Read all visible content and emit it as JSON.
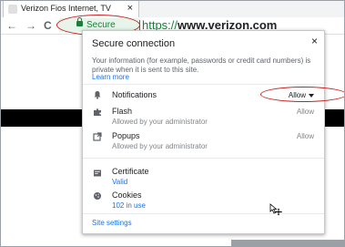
{
  "tab": {
    "title": "Verizon Fios Internet, TV",
    "close": "×"
  },
  "toolbar": {
    "back": "←",
    "forward": "→",
    "reload": "C",
    "secure_label": "Secure",
    "url_scheme": "https://",
    "url_host": "www.verizon.com"
  },
  "popup": {
    "title": "Secure connection",
    "close": "×",
    "description": "Your information (for example, passwords or credit card numbers) is private when it is sent to this site.",
    "learn_more": "Learn more",
    "permissions": [
      {
        "icon": "bell-icon",
        "label": "Notifications",
        "value": "Allow",
        "sub": ""
      },
      {
        "icon": "puzzle-icon",
        "label": "Flash",
        "value": "Allow",
        "sub": "Allowed by your administrator"
      },
      {
        "icon": "popup-icon",
        "label": "Popups",
        "value": "Allow",
        "sub": "Allowed by your administrator"
      }
    ],
    "certificate": {
      "label": "Certificate",
      "status": "Valid"
    },
    "cookies": {
      "label": "Cookies",
      "count": "102 in use"
    },
    "site_settings": "Site settings"
  },
  "colors": {
    "secure_green": "#188038",
    "link_blue": "#1a73e8",
    "annotation_red": "#c5221f"
  }
}
